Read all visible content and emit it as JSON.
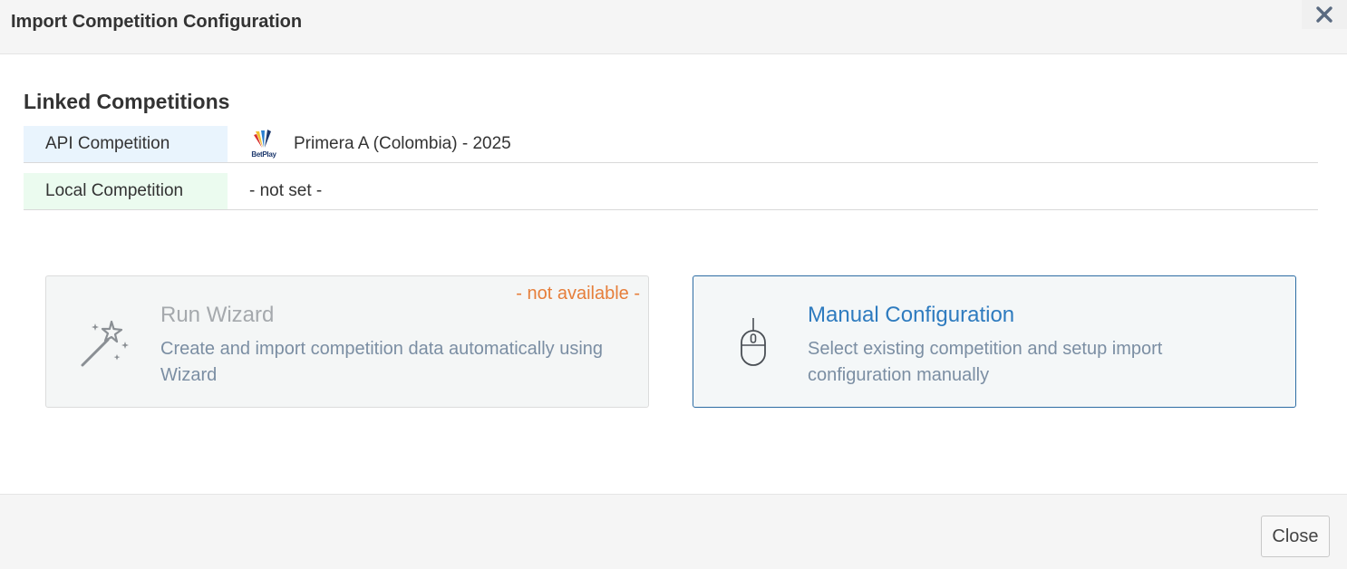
{
  "dialog": {
    "title": "Import Competition Configuration"
  },
  "linked": {
    "title": "Linked Competitions",
    "api": {
      "label": "API Competition",
      "value": "Primera A (Colombia) - 2025",
      "logo_icon": "betplay-league-logo"
    },
    "local": {
      "label": "Local Competition",
      "value": "- not set -"
    }
  },
  "options": {
    "wizard": {
      "title": "Run Wizard",
      "description": "Create and import competition data automatically using Wizard",
      "badge": "- not available -",
      "icon": "magic-wand-icon"
    },
    "manual": {
      "title": "Manual Configuration",
      "description": "Select existing competition and setup import configuration manually",
      "icon": "mouse-icon"
    }
  },
  "footer": {
    "close_label": "Close"
  },
  "colors": {
    "accent": "#2e7bbf",
    "warning": "#e67e3a",
    "api_label_bg": "#e9f4fd",
    "local_label_bg": "#ebfbef"
  }
}
